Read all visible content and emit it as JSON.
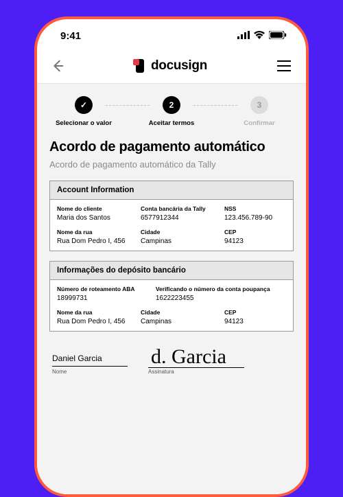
{
  "statusbar": {
    "time": "9:41"
  },
  "header": {
    "brand": "docusign"
  },
  "stepper": {
    "steps": [
      {
        "label": "Selecionar o valor",
        "badge": "✓",
        "active": true
      },
      {
        "label": "Aceitar termos",
        "badge": "2",
        "active": true
      },
      {
        "label": "Confirmar",
        "badge": "3",
        "active": false
      }
    ]
  },
  "document": {
    "title": "Acordo de pagamento automático",
    "subtitle": "Acordo de pagamento automático da Tally",
    "panels": [
      {
        "header": "Account Information",
        "rows": [
          [
            {
              "label": "Nome do cliente",
              "value": "Maria dos Santos"
            },
            {
              "label": "Conta bancária da Tally",
              "value": "6577912344"
            },
            {
              "label": "NSS",
              "value": "123.456.789-90"
            }
          ],
          [
            {
              "label": "Nome da rua",
              "value": "Rua Dom Pedro I, 456"
            },
            {
              "label": "Cidade",
              "value": "Campinas"
            },
            {
              "label": "CEP",
              "value": "94123"
            }
          ]
        ]
      },
      {
        "header": "Informações do depósito bancário",
        "rows": [
          [
            {
              "label": "Número de roteamento ABA",
              "value": "18999731"
            },
            {
              "label": "Verificando o número da conta poupança",
              "value": "1622223455"
            }
          ],
          [
            {
              "label": "Nome da rua",
              "value": "Rua Dom Pedro I, 456"
            },
            {
              "label": "Cidade",
              "value": "Campinas"
            },
            {
              "label": "CEP",
              "value": "94123"
            }
          ]
        ]
      }
    ],
    "signature": {
      "printed_name": "Daniel Garcia",
      "printed_caption": "Nome",
      "signature_text": "d. Garcia",
      "signature_caption": "Assinatura"
    }
  }
}
